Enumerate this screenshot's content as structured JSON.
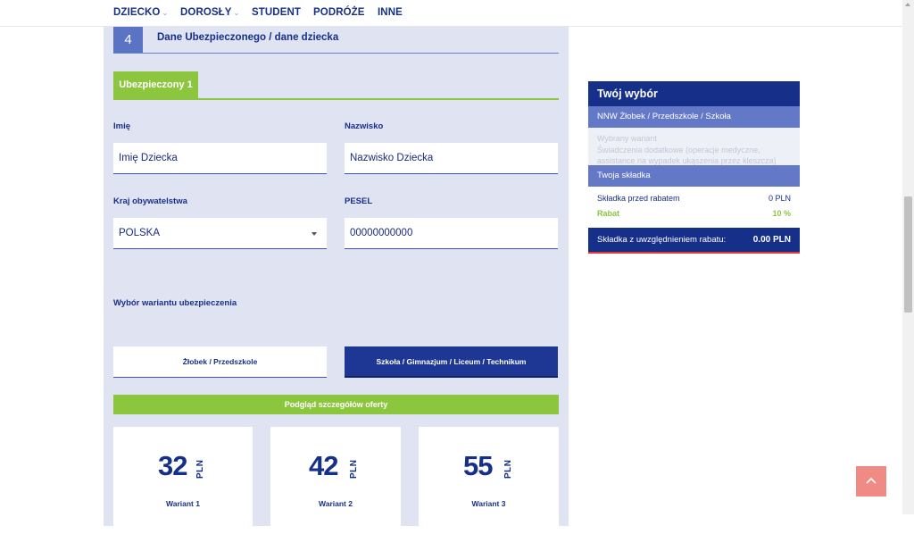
{
  "nav": {
    "items": [
      {
        "label": "DZIECKO",
        "dropdown": true
      },
      {
        "label": "DOROSŁY",
        "dropdown": true
      },
      {
        "label": "STUDENT",
        "dropdown": false
      },
      {
        "label": "PODRÓŻE",
        "dropdown": false
      },
      {
        "label": "INNE",
        "dropdown": false
      }
    ],
    "chevron": "⌄"
  },
  "form": {
    "step_number": "4",
    "step_title": "Dane Ubezpieczonego / dane dziecka",
    "insured_tab": "Ubezpieczony 1",
    "first_name": {
      "label": "Imię",
      "value": "Imię Dziecka"
    },
    "last_name": {
      "label": "Nazwisko",
      "value": "Nazwisko Dziecka"
    },
    "citizenship": {
      "label": "Kraj obywatelstwa",
      "value": "POLSKA"
    },
    "pesel": {
      "label": "PESEL",
      "value": "00000000000"
    },
    "variant_choice_label": "Wybór wariantu ubezpieczenia",
    "variant_options": [
      {
        "label": "Żłobek / Przedszkole",
        "selected": false
      },
      {
        "label": "Szkoła / Gimnazjum / Liceum / Technikum",
        "selected": true
      }
    ],
    "preview_button": "Podgląd szczegółów oferty",
    "price_cards": [
      {
        "amount": "32",
        "currency": "PLN",
        "label": "Wariant 1"
      },
      {
        "amount": "42",
        "currency": "PLN",
        "label": "Wariant 2"
      },
      {
        "amount": "55",
        "currency": "PLN",
        "label": "Wariant 3"
      }
    ]
  },
  "summary": {
    "title": "Twój wybór",
    "product": "NNW Żłobek / Przedszkole / Szkoła",
    "selected_variant_label": "Wybrany wariant",
    "extra_benefits": "Świadczenia dodatkowe (operacje medyczne, assistance na wypadek ukąszenia przez kleszcza)",
    "premium_heading": "Twoja składka",
    "premium_before_label": "Składka przed rabatem",
    "premium_before_value": "0 PLN",
    "discount_label": "Rabat",
    "discount_value": "10 %",
    "total_label": "Składka z uwzględnieniem rabatu:",
    "total_value": "0.00 PLN"
  },
  "colors": {
    "navy": "#16308a",
    "accent_green": "#8cc63f",
    "mid_blue": "#6478c8",
    "panel_bg": "#dfe3f2",
    "back_to_top": "#ef8a84",
    "total_underline": "#e23a3a"
  },
  "icons": {
    "back_to_top": "chevron-up-icon",
    "select_caret": "caret-down-icon"
  }
}
